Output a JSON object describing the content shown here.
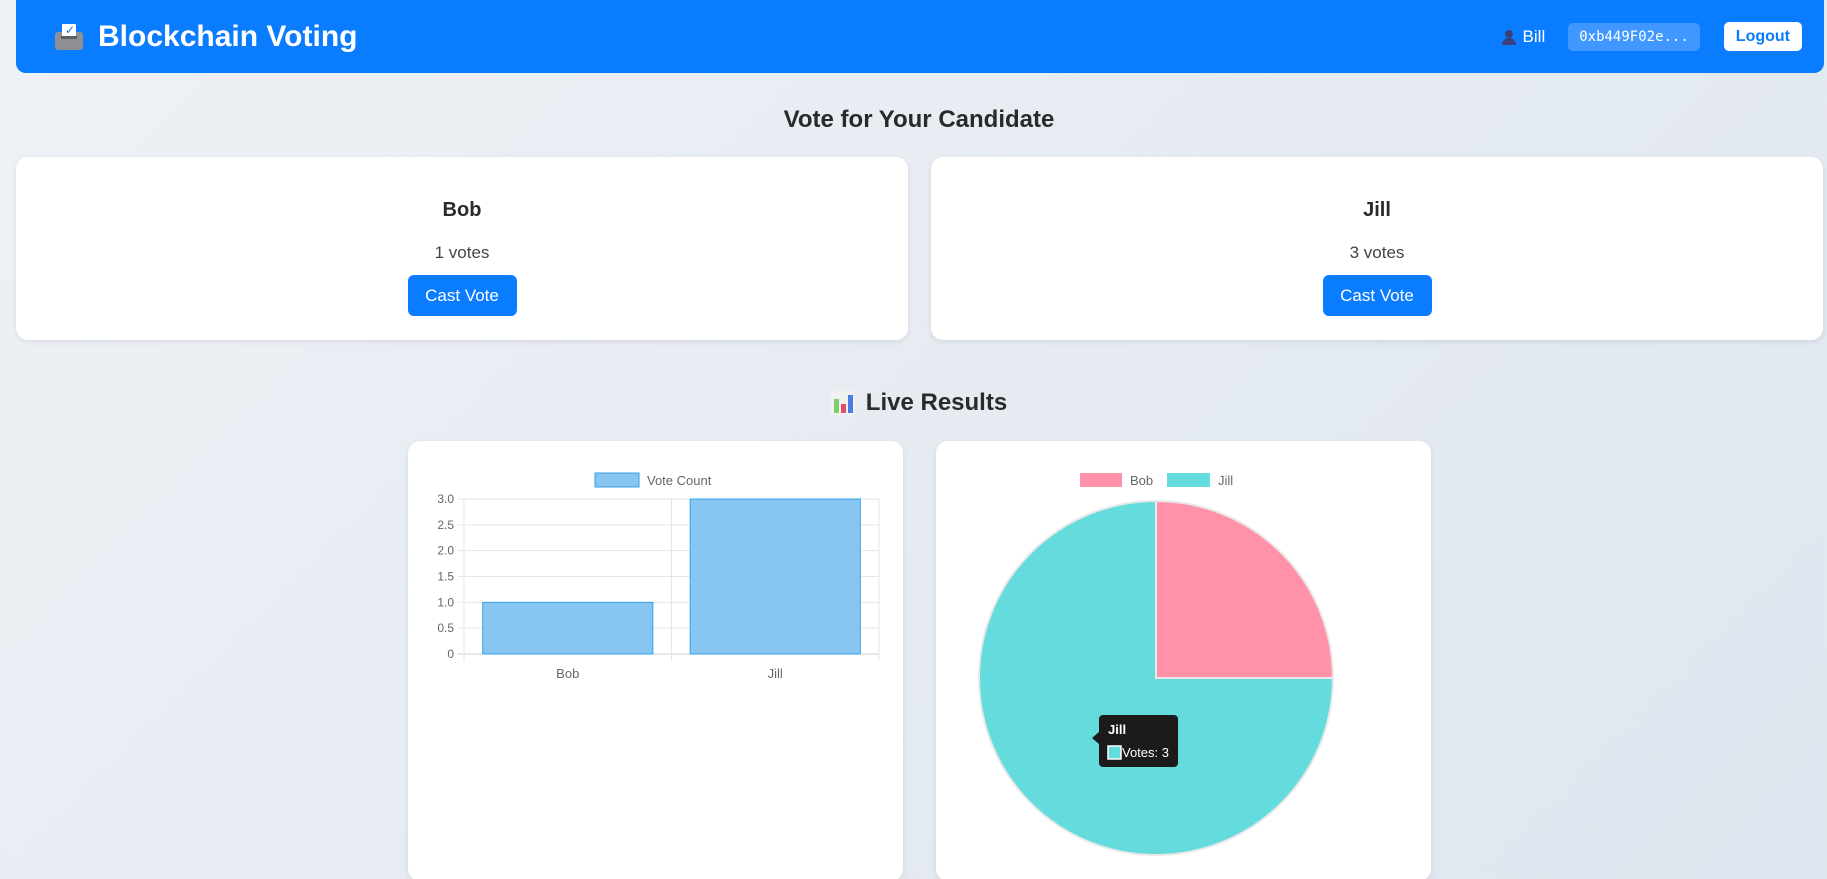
{
  "app": {
    "title": "Blockchain Voting"
  },
  "user": {
    "name": "Bill",
    "address": "0xb449F02e...",
    "logout_label": "Logout"
  },
  "voting": {
    "title": "Vote for Your Candidate",
    "candidates": [
      {
        "name": "Bob",
        "votes_text": "1 votes",
        "button": "Cast Vote"
      },
      {
        "name": "Jill",
        "votes_text": "3 votes",
        "button": "Cast Vote"
      }
    ]
  },
  "results": {
    "title": "Live Results"
  },
  "chart_data": [
    {
      "type": "bar",
      "categories": [
        "Bob",
        "Jill"
      ],
      "series": [
        {
          "name": "Vote Count",
          "values": [
            1,
            3
          ]
        }
      ],
      "ylim": [
        0,
        3
      ],
      "yticks": [
        "0",
        "0.5",
        "1.0",
        "1.5",
        "2.0",
        "2.5",
        "3.0"
      ],
      "grid": true,
      "legend": "top-center",
      "colors": {
        "fill": "#87c6f0",
        "stroke": "#36a2eb"
      }
    },
    {
      "type": "pie",
      "labels": [
        "Bob",
        "Jill"
      ],
      "values": [
        1,
        3
      ],
      "legend": "top-center",
      "colors": [
        "#ff92a9",
        "#64dcde"
      ],
      "tooltip": {
        "title": "Jill",
        "label": "Votes: 3"
      }
    }
  ]
}
